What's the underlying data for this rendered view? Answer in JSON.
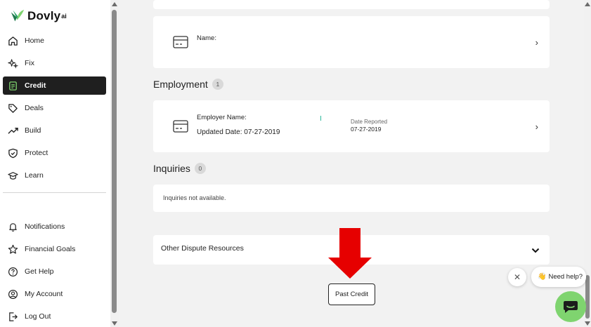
{
  "brand": {
    "name": "Dovly",
    "suffix": "ai"
  },
  "nav": {
    "top": [
      {
        "label": "Home",
        "icon": "home-icon"
      },
      {
        "label": "Fix",
        "icon": "sparkle-icon"
      },
      {
        "label": "Credit",
        "icon": "document-icon",
        "active": true
      },
      {
        "label": "Deals",
        "icon": "tag-icon"
      },
      {
        "label": "Build",
        "icon": "trend-up-icon"
      },
      {
        "label": "Protect",
        "icon": "shield-check-icon"
      },
      {
        "label": "Learn",
        "icon": "graduation-cap-icon"
      }
    ],
    "bottom": [
      {
        "label": "Notifications",
        "icon": "bell-icon"
      },
      {
        "label": "Financial Goals",
        "icon": "star-icon"
      },
      {
        "label": "Get Help",
        "icon": "help-circle-icon"
      },
      {
        "label": "My Account",
        "icon": "user-circle-icon"
      },
      {
        "label": "Log Out",
        "icon": "logout-icon"
      }
    ]
  },
  "name_card": {
    "label": "Name:"
  },
  "employment": {
    "title": "Employment",
    "count": "1",
    "employer_label": "Employer Name:",
    "updated": "Updated Date: 07-27-2019",
    "date_reported_label": "Date Reported",
    "date_reported_value": "07-27-2019"
  },
  "inquiries": {
    "title": "Inquiries",
    "count": "0",
    "empty_text": "Inquiries not available."
  },
  "other_resources": {
    "title": "Other Dispute Resources"
  },
  "past_credit_button": "Past Credit",
  "chat": {
    "prompt": "Need help?",
    "wave": "👋"
  },
  "colors": {
    "accent_green": "#7fd46f",
    "annotation_red": "#e60000",
    "active_nav": "#1f1f1f"
  }
}
